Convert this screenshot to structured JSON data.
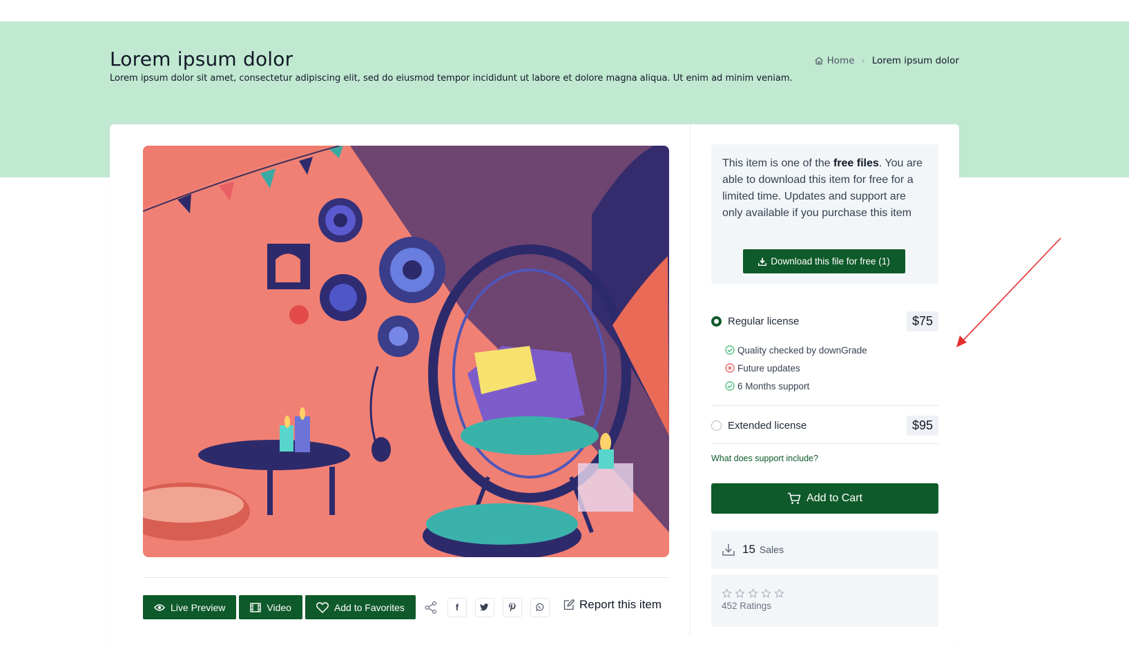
{
  "header": {
    "title": "Lorem ipsum dolor",
    "description": "Lorem ipsum dolor sit amet, consectetur adipiscing elit, sed do eiusmod tempor incididunt ut labore et dolore magna aliqua. Ut enim ad minim veniam."
  },
  "breadcrumb": {
    "home": "Home",
    "current": "Lorem ipsum dolor"
  },
  "free_box": {
    "text_before": "This item is one of the ",
    "text_bold": "free files",
    "text_after": ". You are able to download this item for free for a limited time. Updates and support are only available if you purchase this item",
    "download_label": "Download this file for free (1)"
  },
  "licenses": [
    {
      "name": "Regular license",
      "price": "$75",
      "selected": true,
      "features": [
        {
          "label": "Quality checked by downGrade",
          "included": true
        },
        {
          "label": "Future updates",
          "included": false
        },
        {
          "label": "6 Months support",
          "included": true
        }
      ]
    },
    {
      "name": "Extended license",
      "price": "$95",
      "selected": false
    }
  ],
  "support_link": "What does support include?",
  "cart_label": "Add to Cart",
  "sales": {
    "count": "15",
    "label": "Sales"
  },
  "ratings": {
    "stars": 0,
    "max": 5,
    "label": "452 Ratings"
  },
  "actions": {
    "live_preview": "Live Preview",
    "video": "Video",
    "favorites": "Add to Favorites",
    "report": "Report this item",
    "facebook": "f"
  },
  "colors": {
    "accent": "#0f5a2a",
    "hero_bg": "#c1e8d1",
    "annotation_arrow": "#e5302f"
  }
}
